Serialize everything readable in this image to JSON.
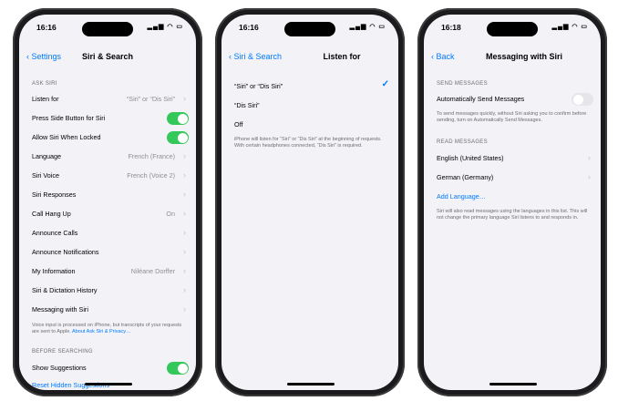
{
  "screen1": {
    "time": "16:16",
    "back": "Settings",
    "title": "Siri & Search",
    "section_ask": "ASK SIRI",
    "rows": [
      {
        "label": "Listen for",
        "value": "“Siri” or “Dis Siri”"
      },
      {
        "label": "Press Side Button for Siri",
        "toggle": "on"
      },
      {
        "label": "Allow Siri When Locked",
        "toggle": "on"
      },
      {
        "label": "Language",
        "value": "French (France)"
      },
      {
        "label": "Siri Voice",
        "value": "French (Voice 2)"
      },
      {
        "label": "Siri Responses",
        "value": ""
      },
      {
        "label": "Call Hang Up",
        "value": "On"
      },
      {
        "label": "Announce Calls",
        "value": ""
      },
      {
        "label": "Announce Notifications",
        "value": ""
      },
      {
        "label": "My Information",
        "value": "Niléane Dorffer"
      },
      {
        "label": "Siri & Dictation History",
        "value": ""
      },
      {
        "label": "Messaging with Siri",
        "value": ""
      }
    ],
    "footer_text": "Voice input is processed on iPhone, but transcripts of your requests are sent to Apple.",
    "footer_link": "About Ask Siri & Privacy…",
    "section_before": "BEFORE SEARCHING",
    "show_suggestions": "Show Suggestions",
    "reset_link": "Reset Hidden Suggestions"
  },
  "screen2": {
    "time": "16:16",
    "back": "Siri & Search",
    "title": "Listen for",
    "options": [
      {
        "label": "“Siri” or “Dis Siri”",
        "selected": true
      },
      {
        "label": "“Dis Siri”",
        "selected": false
      },
      {
        "label": "Off",
        "selected": false
      }
    ],
    "checkmark": "✓",
    "footer": "iPhone will listen for “Siri” or “Dis Siri” at the beginning of requests. With certain headphones connected, “Dis Siri” is required."
  },
  "screen3": {
    "time": "16:18",
    "back": "Back",
    "title": "Messaging with Siri",
    "section_send": "SEND MESSAGES",
    "auto_send": "Automatically Send Messages",
    "send_footer": "To send messages quickly, without Siri asking you to confirm before sending, turn on Automatically Send Messages.",
    "section_read": "READ MESSAGES",
    "languages": [
      "English (United States)",
      "German (Germany)"
    ],
    "add_language": "Add Language…",
    "read_footer": "Siri will also read messages using the languages in this list. This will not change the primary language Siri listens to and responds in."
  }
}
